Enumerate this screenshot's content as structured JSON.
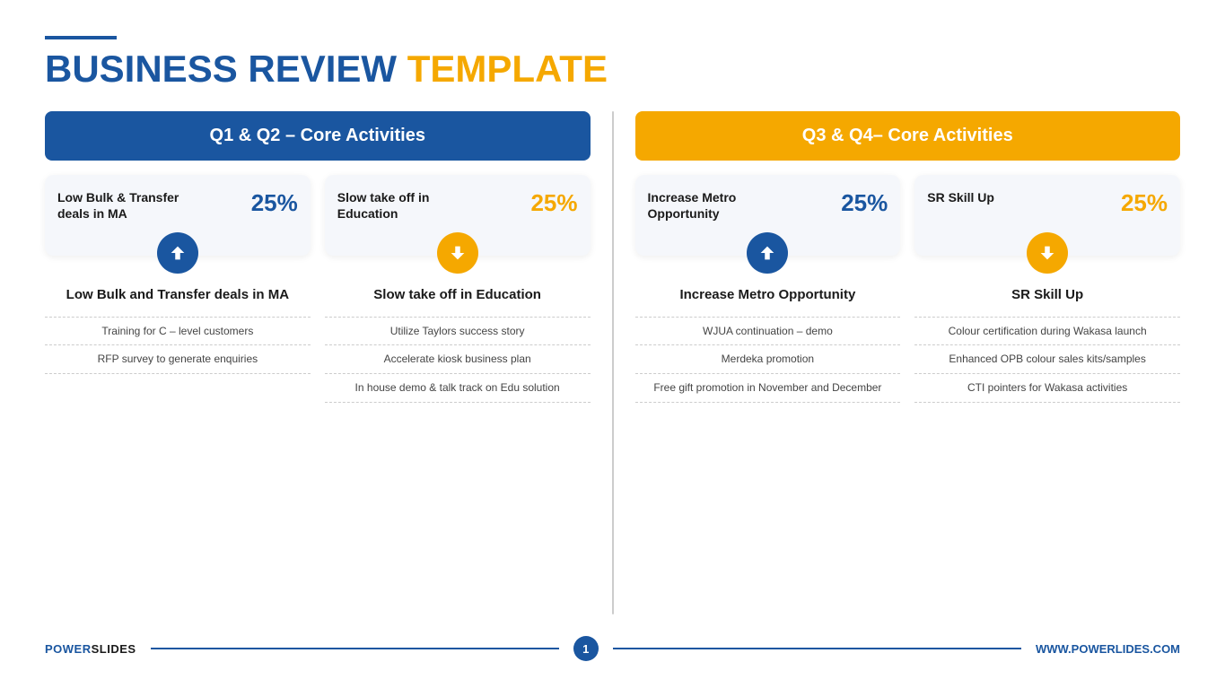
{
  "header": {
    "accent": true,
    "title_black": "BUSINESS REVIEW",
    "title_colored": "TEMPLATE",
    "title_color": "yellow"
  },
  "left_panel": {
    "header": "Q1 & Q2 – Core Activities",
    "header_color": "blue",
    "columns": [
      {
        "stat_label": "Low Bulk & Transfer deals in MA",
        "stat_pct": "25%",
        "pct_color": "blue",
        "arrow_dir": "up",
        "arrow_color": "blue",
        "item_title": "Low Bulk and Transfer deals in MA",
        "bullets": [
          "Training for C – level customers",
          "RFP survey to generate enquiries"
        ]
      },
      {
        "stat_label": "Slow take off in Education",
        "stat_pct": "25%",
        "pct_color": "yellow",
        "arrow_dir": "down",
        "arrow_color": "yellow",
        "item_title": "Slow take off in Education",
        "bullets": [
          "Utilize Taylors success story",
          "Accelerate kiosk business plan",
          "In house demo & talk track on Edu solution"
        ]
      }
    ]
  },
  "right_panel": {
    "header": "Q3 & Q4– Core Activities",
    "header_color": "yellow",
    "columns": [
      {
        "stat_label": "Increase Metro Opportunity",
        "stat_pct": "25%",
        "pct_color": "blue",
        "arrow_dir": "up",
        "arrow_color": "blue",
        "item_title": "Increase Metro Opportunity",
        "bullets": [
          "WJUA continuation – demo",
          "Merdeka promotion",
          "Free gift promotion in November and December"
        ]
      },
      {
        "stat_label": "SR Skill Up",
        "stat_pct": "25%",
        "pct_color": "yellow",
        "arrow_dir": "down",
        "arrow_color": "yellow",
        "item_title": "SR Skill Up",
        "bullets": [
          "Colour certification during Wakasa launch",
          "Enhanced OPB colour sales kits/samples",
          "CTI pointers for Wakasa activities"
        ]
      }
    ]
  },
  "footer": {
    "left_label": "POWERSLIDES",
    "page_number": "1",
    "right_label": "WWW.POWERLIDES.COM"
  }
}
